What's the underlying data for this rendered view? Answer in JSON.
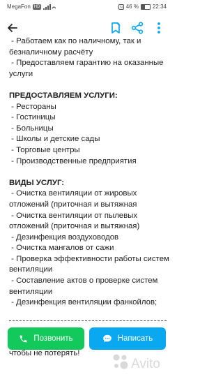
{
  "status_bar": {
    "carrier": "MegaFon",
    "network_badge": "HD",
    "battery_text": "46 %",
    "battery_level": 0.46,
    "time": "22:34"
  },
  "app_bar": {
    "back_icon": "arrow-left-icon",
    "bookmark_icon": "bookmark-edit-icon",
    "share_icon": "share-icon",
    "more_icon": "more-vertical-icon",
    "accent_color": "#0aa8f0"
  },
  "content": {
    "lines": [
      {
        "text": " - Работаем как по наличному, так и",
        "style": "normal"
      },
      {
        "text": "безналичному расчёту",
        "style": "normal"
      },
      {
        "text": " - Предоставляем гарантию на оказанные",
        "style": "normal"
      },
      {
        "text": "услуги",
        "style": "normal"
      },
      {
        "text": "",
        "style": "blank"
      },
      {
        "text": "ПРЕДОСТАВЛЯЕМ УСЛУГИ:",
        "style": "heading"
      },
      {
        "text": " - Рестораны",
        "style": "normal"
      },
      {
        "text": " - Гостиницы",
        "style": "normal"
      },
      {
        "text": " - Больницы",
        "style": "normal"
      },
      {
        "text": " - Школы и детские сады",
        "style": "normal"
      },
      {
        "text": " - Торговые центры",
        "style": "normal"
      },
      {
        "text": " - Производственные предприятия",
        "style": "normal"
      },
      {
        "text": "",
        "style": "blank"
      },
      {
        "text": "ВИДЫ УСЛУГ:",
        "style": "heading"
      },
      {
        "text": " - Очистка вентиляции от жировых",
        "style": "normal"
      },
      {
        "text": "отложений (приточная и вытяжная",
        "style": "normal"
      },
      {
        "text": " - Очистка вентиляции от пылевых",
        "style": "normal"
      },
      {
        "text": "отложений (приточная и вытяжная)",
        "style": "normal"
      },
      {
        "text": " - Дезинфекция воздуховодов",
        "style": "normal"
      },
      {
        "text": " - Очистка мангалов от сажи",
        "style": "normal"
      },
      {
        "text": " - Проверка эффективности работы систем",
        "style": "normal"
      },
      {
        "text": "вентиляции",
        "style": "normal"
      },
      {
        "text": " - Составление актов о проверке систем",
        "style": "normal"
      },
      {
        "text": "вентиляции",
        "style": "normal"
      },
      {
        "text": " - Дезинфекция вентиляции фанкойлов;",
        "style": "normal"
      }
    ],
    "tail_text": "чтобы не потерять!"
  },
  "actions": {
    "call_label": "Позвонить",
    "write_label": "Написать",
    "call_color": "#13c95c",
    "write_color": "#0aa8f0",
    "call_icon": "phone-icon",
    "write_icon": "chat-bubble-icon"
  },
  "watermark": {
    "text": "Avito",
    "icon": "avito-logo-icon"
  }
}
